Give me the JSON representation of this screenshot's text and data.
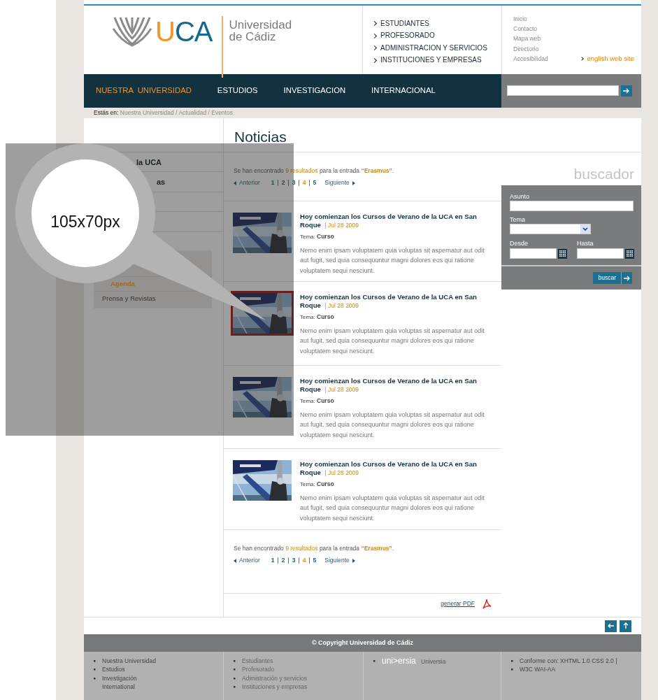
{
  "header": {
    "logo": {
      "wordmark": "UCA",
      "name_lines": [
        "Universidad",
        "de Cádiz"
      ]
    },
    "audience_links": [
      "ESTUDIANTES",
      "PROFESORADO",
      "ADMINISTRACION Y SERVICIOS",
      "INSTITUCIONES Y EMPRESAS"
    ],
    "utility_links": [
      "Inicio",
      "Contacto",
      "Mapa web",
      "Directorio",
      "Accesibilidad"
    ],
    "english_link": "english web site"
  },
  "nav": {
    "items": [
      {
        "label": "NUESTRA  UNIVERSIDAD",
        "selected": true
      },
      {
        "label": "ESTUDIOS",
        "selected": false
      },
      {
        "label": "INVESTIGACION",
        "selected": false
      },
      {
        "label": "INTERNACIONAL",
        "selected": false
      }
    ]
  },
  "breadcrumb": {
    "label": "Estás en:",
    "items": [
      "Nuestra Universidad",
      "Actualidad",
      "Eventos"
    ],
    "separator": "/"
  },
  "page_title": "Noticias",
  "sidebar": {
    "items": [
      {
        "label": "la UCA"
      },
      {
        "label": "as"
      }
    ],
    "submenu": [
      {
        "label": "Agenda",
        "selected": true
      },
      {
        "label": "Prensa y Revistas",
        "selected": false
      }
    ]
  },
  "results_summaries": [
    {
      "prefix": "Se han encontrado",
      "count": "9 resultados",
      "middle": "para la entrada",
      "query": "“Erasmus”",
      "suffix": "."
    },
    {
      "prefix": "Se han encontrado",
      "count": "9 resultados",
      "middle": "para la entrada",
      "query": "“Erasmus”",
      "suffix": "."
    }
  ],
  "paginations": [
    {
      "previous": "Anterior",
      "next": "Siguiente",
      "separator": "|",
      "pages": [
        {
          "label": "1",
          "selected": false
        },
        {
          "label": "2",
          "selected": false
        },
        {
          "label": "3",
          "selected": false
        },
        {
          "label": "4",
          "selected": true
        },
        {
          "label": "5",
          "selected": false
        }
      ]
    },
    {
      "previous": "Anterior",
      "next": "Siguiente",
      "separator": "|",
      "pages": [
        {
          "label": "1",
          "selected": false
        },
        {
          "label": "2",
          "selected": false
        },
        {
          "label": "3",
          "selected": false
        },
        {
          "label": "4",
          "selected": true
        },
        {
          "label": "5",
          "selected": false
        }
      ]
    }
  ],
  "articles": [
    {
      "title": "Hoy comienzan los Cursos de Verano de la UCA en San Roque",
      "date": "| Jul 28 2009",
      "topic_label": "Tema:",
      "topic": "Curso",
      "text": "Nemo enim ipsam voluptatem quia voluptas sit aspernatur aut odit aut fugit, sed quia consequuntur magni dolores eos qui ratione voluptatem sequi nesciunt.",
      "highlighted": false
    },
    {
      "title": "Hoy comienzan los Cursos de Verano de la UCA en San Roque",
      "date": "| Jul 28 2009",
      "topic_label": "Tema:",
      "topic": "Curso",
      "text": "Nemo enim ipsam voluptatem quia voluptas sit aspernatur aut odit aut fugit, sed quia consequuntur magni dolores eos qui ratione voluptatem sequi nesciunt.",
      "highlighted": true
    },
    {
      "title": "Hoy comienzan los Cursos de Verano de la UCA en San Roque",
      "date": "| Jul 28 2009",
      "topic_label": "Tema:",
      "topic": "Curso",
      "text": "Nemo enim ipsam voluptatem quia voluptas sit aspernatur aut odit aut fugit, sed quia consequuntur magni dolores eos qui ratione voluptatem sequi nesciunt.",
      "highlighted": false
    },
    {
      "title": "Hoy comienzan los Cursos de Verano de la UCA en San Roque",
      "date": "| Jul 28 2009",
      "topic_label": "Tema:",
      "topic": "Curso",
      "text": "Nemo enim ipsam voluptatem quia voluptas sit aspernatur aut odit aut fugit, sed quia consequuntur magni dolores eos qui ratione voluptatem sequi nesciunt.",
      "highlighted": false
    }
  ],
  "pdf_link": "generar PDF",
  "search_panel": {
    "title": "buscador",
    "subject_label": "Asunto",
    "topic_label": "Tema",
    "from_label": "Desde",
    "to_label": "Hasta",
    "button": "buscar"
  },
  "annotation": {
    "label": "105x70px"
  },
  "footer": {
    "copyright": "© Copyright Universidad de Cádiz",
    "columns": [
      {
        "kind": "list",
        "items": [
          "Nuestra Universidad",
          "Estudios",
          "Investigación\nInternational"
        ]
      },
      {
        "kind": "list",
        "items": [
          "Estudiantes",
          "Profesorado",
          "Adimistración y servicios",
          "Instituciones y empresas"
        ]
      },
      {
        "kind": "partner",
        "logo": "uni>ersia",
        "name": "Universia"
      },
      {
        "kind": "list",
        "items": [
          "Conforme con: XHTML 1.0  CSS 2.0 |",
          "W3C  WAI-AA"
        ]
      }
    ]
  }
}
